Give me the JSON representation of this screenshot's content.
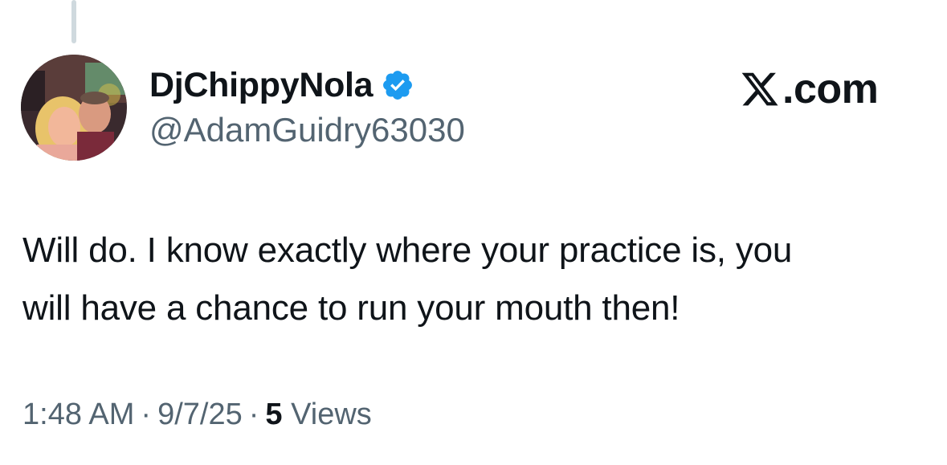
{
  "tweet": {
    "display_name": "DjChippyNola",
    "handle": "@AdamGuidry63030",
    "verified": true,
    "text_line1": "Will do. I know exactly where your practice is, you",
    "text_line2": "will have a chance to run your mouth then!",
    "time": "1:48 AM",
    "separator": "·",
    "date": "9/7/25",
    "views_count": "5",
    "views_label": "Views"
  },
  "brand": {
    "domain": ".com",
    "logo_icon": "x-logo-icon"
  },
  "colors": {
    "verified_blue": "#1d9bf0",
    "secondary_text": "#536471",
    "primary_text": "#0f1419",
    "thread_line": "#cfd9de"
  }
}
